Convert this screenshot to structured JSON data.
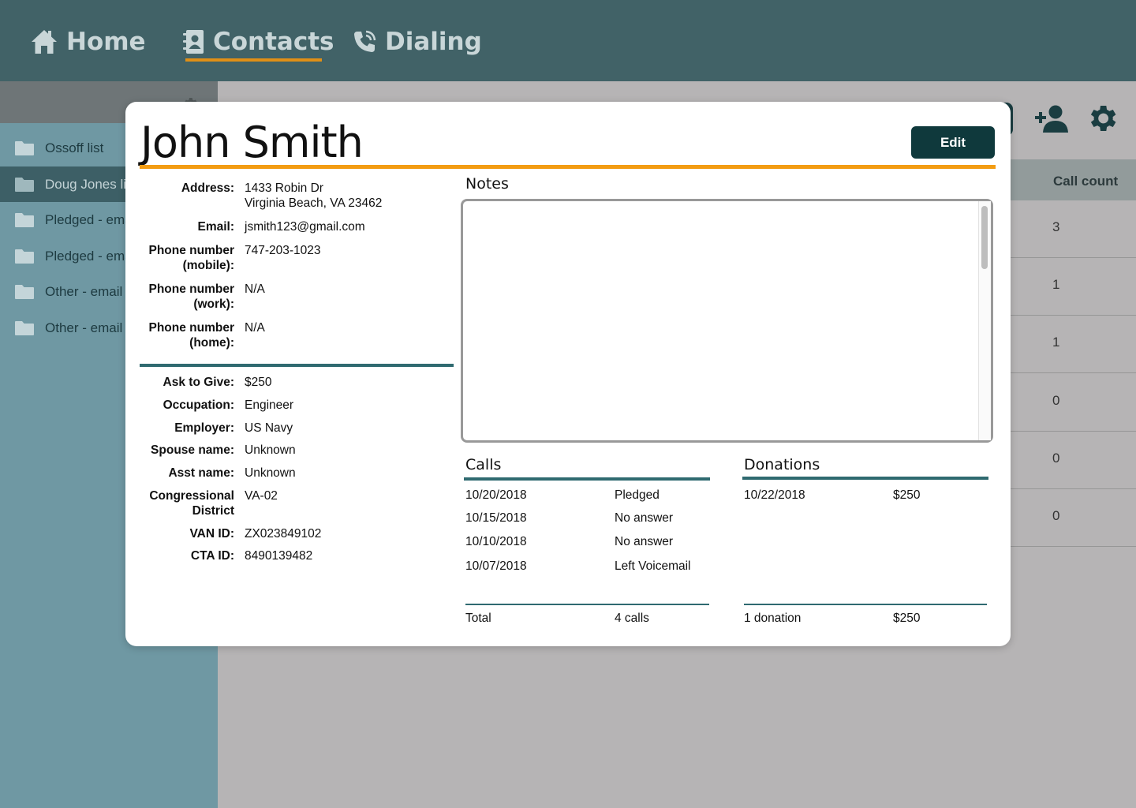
{
  "nav": {
    "home": "Home",
    "contacts": "Contacts",
    "dialing": "Dialing"
  },
  "sidebar": {
    "items": [
      {
        "label": "Ossoff list"
      },
      {
        "label": "Doug Jones list"
      },
      {
        "label": "Pledged - email"
      },
      {
        "label": "Pledged - email"
      },
      {
        "label": "Other - email"
      },
      {
        "label": "Other - email"
      }
    ]
  },
  "table": {
    "call_count_header": "Call count",
    "call_counts": [
      "3",
      "1",
      "1",
      "0",
      "0",
      "0"
    ]
  },
  "contact": {
    "name": "John Smith",
    "edit_label": "Edit",
    "address_label": "Address:",
    "address_line1": "1433 Robin Dr",
    "address_line2": "Virginia Beach, VA 23462",
    "email_label": "Email:",
    "email": "jsmith123@gmail.com",
    "phone_mobile_label1": "Phone number",
    "phone_mobile_label2": "(mobile):",
    "phone_mobile": "747-203-1023",
    "phone_work_label1": "Phone number",
    "phone_work_label2": "(work):",
    "phone_work": "N/A",
    "phone_home_label1": "Phone number",
    "phone_home_label2": "(home):",
    "phone_home": "N/A",
    "ask_label": "Ask to Give:",
    "ask": "$250",
    "occupation_label": "Occupation:",
    "occupation": "Engineer",
    "employer_label": "Employer:",
    "employer": "US Navy",
    "spouse_label": "Spouse name:",
    "spouse": "Unknown",
    "asst_label": "Asst name:",
    "asst": "Unknown",
    "district_label1": "Congressional",
    "district_label2": "District",
    "district": "VA-02",
    "van_label": "VAN ID:",
    "van": "ZX023849102",
    "cta_label": "CTA ID:",
    "cta": "8490139482"
  },
  "notes": {
    "heading": "Notes"
  },
  "calls": {
    "heading": "Calls",
    "rows": [
      {
        "date": "10/20/2018",
        "result": "Pledged"
      },
      {
        "date": "10/15/2018",
        "result": "No answer"
      },
      {
        "date": "10/10/2018",
        "result": "No answer"
      },
      {
        "date": "10/07/2018",
        "result": "Left Voicemail"
      }
    ],
    "total_label": "Total",
    "total_value": "4 calls"
  },
  "donations": {
    "heading": "Donations",
    "rows": [
      {
        "date": "10/22/2018",
        "amount": "$250"
      }
    ],
    "total_label": "1 donation",
    "total_value": "$250"
  }
}
